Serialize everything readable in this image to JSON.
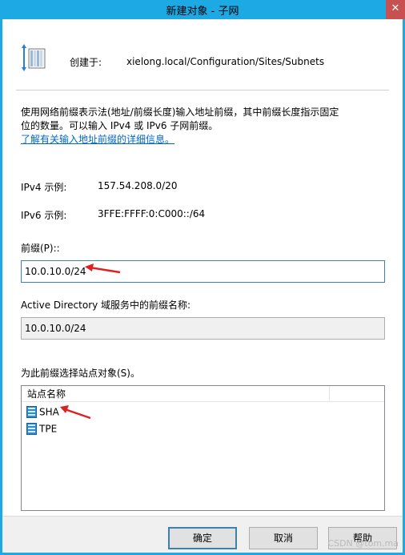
{
  "window": {
    "title": "新建对象 - 子网",
    "close_glyph": "✕"
  },
  "header": {
    "icon": "subnet-object-icon",
    "created_in_label": "创建于:",
    "created_in_path": "xielong.local/Configuration/Sites/Subnets"
  },
  "description": {
    "line1": "使用网络前缀表示法(地址/前缀长度)输入地址前缀，其中前缀长度指示固定",
    "line2": "位的数量。可以输入 IPv4 或 IPv6 子网前缀。",
    "link": "了解有关输入地址前缀的详细信息。"
  },
  "examples": {
    "ipv4_label": "IPv4 示例:",
    "ipv4_value": "157.54.208.0/20",
    "ipv6_label": "IPv6 示例:",
    "ipv6_value": "3FFE:FFFF:0:C000::/64"
  },
  "prefix": {
    "label": "前缀(P)::",
    "value": "10.0.10.0/24"
  },
  "ad_prefix": {
    "label": "Active Directory 域服务中的前缀名称:",
    "value": "10.0.10.0/24"
  },
  "sites": {
    "label": "为此前缀选择站点对象(S)。",
    "column_header": "站点名称",
    "items": [
      {
        "name": "SHA",
        "icon": "site-icon"
      },
      {
        "name": "TPE",
        "icon": "site-icon"
      }
    ]
  },
  "buttons": {
    "ok": "确定",
    "cancel": "取消",
    "help": "帮助"
  },
  "annotations": {
    "arrow_color": "#e02020"
  },
  "watermark": "CSDN @tom.ma",
  "colors": {
    "titlebar": "#1da9e3",
    "link": "#0066cc"
  }
}
